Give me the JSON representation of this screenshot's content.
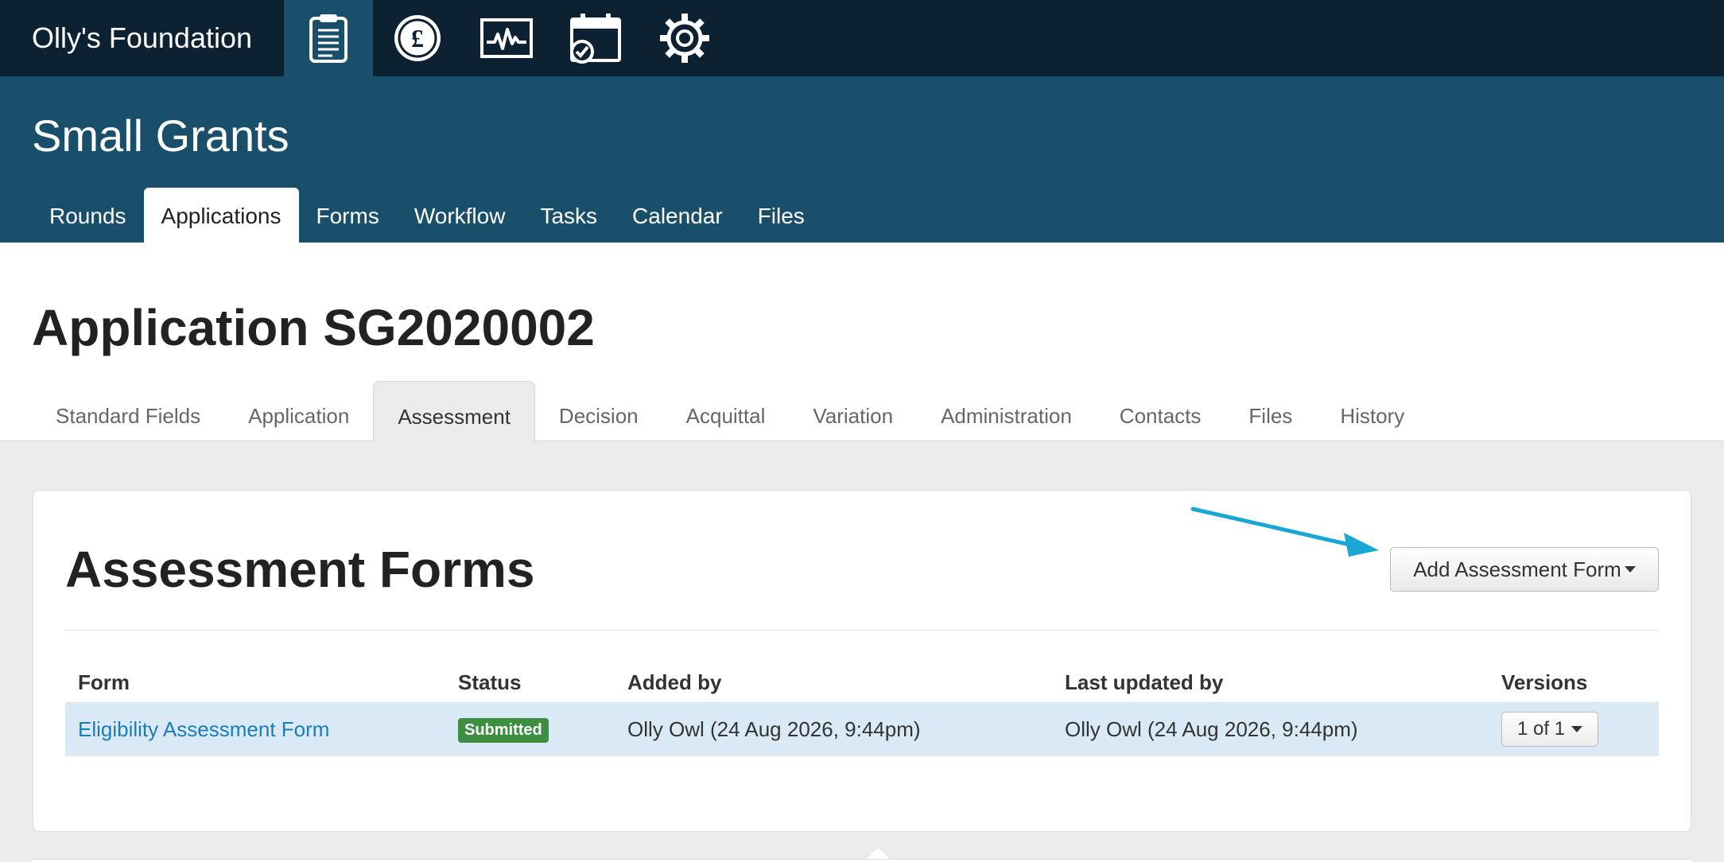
{
  "topbar": {
    "org_name": "Olly's Foundation",
    "icons": [
      {
        "name": "applications-clipboard-icon",
        "active": true
      },
      {
        "name": "payments-pound-icon",
        "active": false
      },
      {
        "name": "reports-activity-icon",
        "active": false
      },
      {
        "name": "calendar-check-icon",
        "active": false
      },
      {
        "name": "settings-gear-icon",
        "active": false
      }
    ]
  },
  "program": {
    "title": "Small Grants",
    "nav": [
      "Rounds",
      "Applications",
      "Forms",
      "Workflow",
      "Tasks",
      "Calendar",
      "Files"
    ],
    "active_nav": "Applications"
  },
  "application": {
    "title": "Application SG2020002",
    "tabs": [
      "Standard Fields",
      "Application",
      "Assessment",
      "Decision",
      "Acquittal",
      "Variation",
      "Administration",
      "Contacts",
      "Files",
      "History"
    ],
    "active_tab": "Assessment"
  },
  "panel": {
    "title": "Assessment Forms",
    "add_button_label": "Add Assessment Form",
    "columns": [
      "Form",
      "Status",
      "Added by",
      "Last updated by",
      "Versions"
    ],
    "rows": [
      {
        "form": "Eligibility Assessment Form",
        "status": "Submitted",
        "added_by": "Olly Owl (24 Aug 2026, 9:44pm)",
        "updated_by": "Olly Owl (24 Aug 2026, 9:44pm)",
        "versions": "1 of 1"
      }
    ]
  },
  "colors": {
    "topbar_bg": "#0c2233",
    "header_bg": "#1a4f6b",
    "link": "#1c7db6",
    "status_submitted": "#3e8e41",
    "annotation_arrow": "#1aa7d6",
    "row_highlight": "#d9eaf6"
  }
}
